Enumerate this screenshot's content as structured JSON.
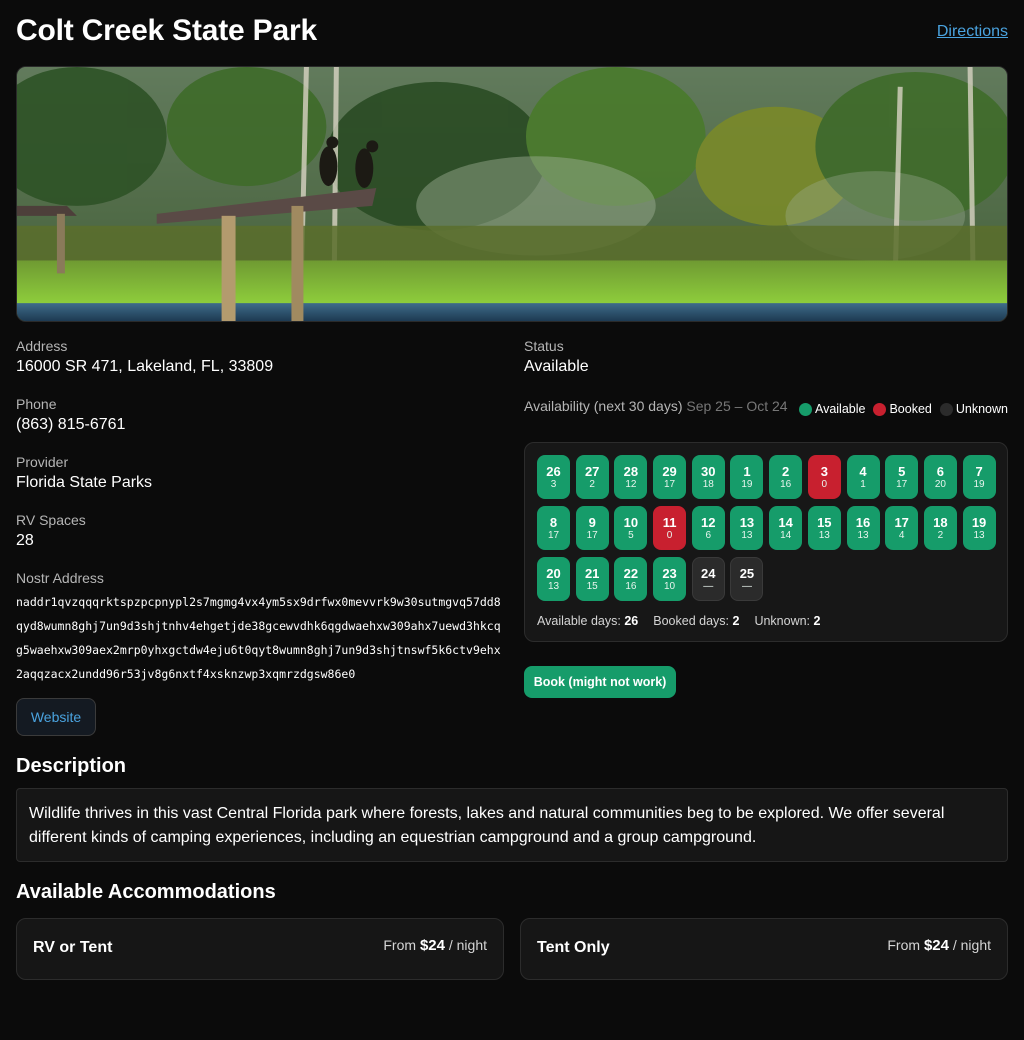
{
  "park": {
    "name": "Colt Creek State Park",
    "directions_label": "Directions",
    "hero_image": "park-photo"
  },
  "details": {
    "address_label": "Address",
    "address": "16000 SR 471, Lakeland, FL, 33809",
    "phone_label": "Phone",
    "phone": "(863) 815-6761",
    "provider_label": "Provider",
    "provider": "Florida State Parks",
    "rv_label": "RV Spaces",
    "rv_spaces": "28",
    "nostr_label": "Nostr Address",
    "nostr_address": "naddr1qvzqqqrktspzpcpnypl2s7mgmg4vx4ym5sx9drfwx0mevvrk9w30sutmgvq57dd8qyd8wumn8ghj7un9d3shjtnhv4ehgetjde38gcewvdhk6qgdwaehxw309ahx7uewd3hkcqg5waehxw309aex2mrp0yhxgctdw4eju6t0qyt8wumn8ghj7un9d3shjtnswf5k6ctv9ehx2aqqzacx2undd96r53jv8g6nxtf4xsknzwp3xqmrzdgsw86e0",
    "website_label": "Website"
  },
  "status": {
    "label": "Status",
    "value": "Available",
    "availability_title": "Availability (next 30 days)",
    "availability_range": "Sep 25 – Oct 24",
    "legend": [
      {
        "label": "Available",
        "color": "#169c6a"
      },
      {
        "label": "Booked",
        "color": "#c8202f"
      },
      {
        "label": "Unknown",
        "color": "#2b2b2b"
      }
    ]
  },
  "calendar": {
    "days": [
      {
        "day": "26",
        "count": "3",
        "state": "available"
      },
      {
        "day": "27",
        "count": "2",
        "state": "available"
      },
      {
        "day": "28",
        "count": "12",
        "state": "available"
      },
      {
        "day": "29",
        "count": "17",
        "state": "available"
      },
      {
        "day": "30",
        "count": "18",
        "state": "available"
      },
      {
        "day": "1",
        "count": "19",
        "state": "available"
      },
      {
        "day": "2",
        "count": "16",
        "state": "available"
      },
      {
        "day": "3",
        "count": "0",
        "state": "booked"
      },
      {
        "day": "4",
        "count": "1",
        "state": "available"
      },
      {
        "day": "5",
        "count": "17",
        "state": "available"
      },
      {
        "day": "6",
        "count": "20",
        "state": "available"
      },
      {
        "day": "7",
        "count": "19",
        "state": "available"
      },
      {
        "day": "8",
        "count": "17",
        "state": "available"
      },
      {
        "day": "9",
        "count": "17",
        "state": "available"
      },
      {
        "day": "10",
        "count": "5",
        "state": "available"
      },
      {
        "day": "11",
        "count": "0",
        "state": "booked"
      },
      {
        "day": "12",
        "count": "6",
        "state": "available"
      },
      {
        "day": "13",
        "count": "13",
        "state": "available"
      },
      {
        "day": "14",
        "count": "14",
        "state": "available"
      },
      {
        "day": "15",
        "count": "13",
        "state": "available"
      },
      {
        "day": "16",
        "count": "13",
        "state": "available"
      },
      {
        "day": "17",
        "count": "4",
        "state": "available"
      },
      {
        "day": "18",
        "count": "2",
        "state": "available"
      },
      {
        "day": "19",
        "count": "13",
        "state": "available"
      },
      {
        "day": "20",
        "count": "13",
        "state": "available"
      },
      {
        "day": "21",
        "count": "15",
        "state": "available"
      },
      {
        "day": "22",
        "count": "16",
        "state": "available"
      },
      {
        "day": "23",
        "count": "10",
        "state": "available"
      },
      {
        "day": "24",
        "count": "—",
        "state": "unknown"
      },
      {
        "day": "25",
        "count": "—",
        "state": "unknown"
      }
    ],
    "available_label": "Available days:",
    "available_days": "26",
    "booked_label": "Booked days:",
    "booked_days": "2",
    "unknown_label": "Unknown:",
    "unknown_days": "2"
  },
  "book_button_label": "Book (might not work)",
  "description": {
    "title": "Description",
    "text": "Wildlife thrives in this vast Central Florida park where forests, lakes and natural communities beg to be explored. We offer several different kinds of camping experiences, including an equestrian campground and a group campground."
  },
  "accommodations": {
    "title": "Available Accommodations",
    "items": [
      {
        "name": "RV or Tent",
        "from": "From",
        "price": "$24",
        "unit": "/ night"
      },
      {
        "name": "Tent Only",
        "from": "From",
        "price": "$24",
        "unit": "/ night"
      }
    ]
  }
}
